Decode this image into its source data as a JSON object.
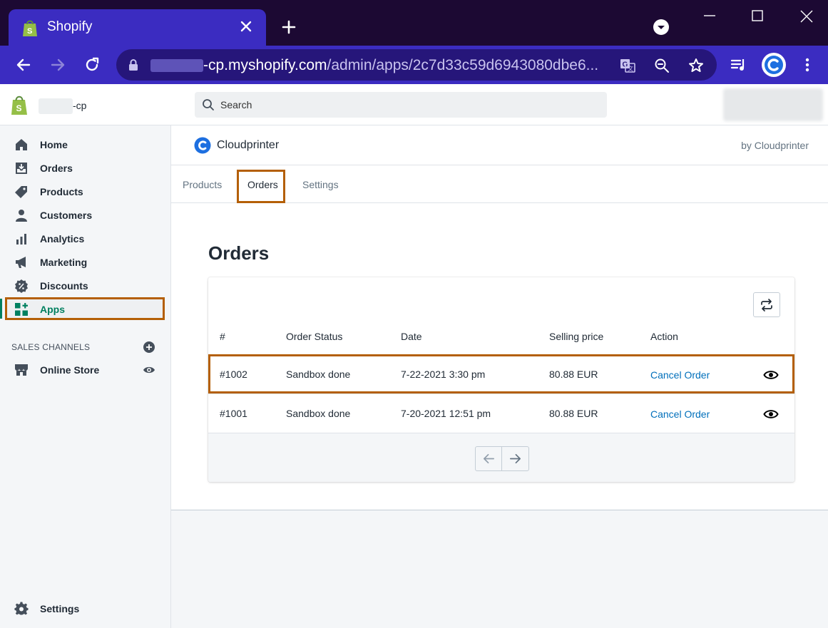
{
  "browser": {
    "tab_title": "Shopify",
    "url_host": "-cp.myshopify.com",
    "url_path": "/admin/apps/2c7d33c59d6943080dbe6..."
  },
  "topbar": {
    "store_name": "-cp",
    "search_placeholder": "Search"
  },
  "sidebar": {
    "items": [
      {
        "label": "Home",
        "icon": "home-icon"
      },
      {
        "label": "Orders",
        "icon": "orders-icon"
      },
      {
        "label": "Products",
        "icon": "tag-icon"
      },
      {
        "label": "Customers",
        "icon": "person-icon"
      },
      {
        "label": "Analytics",
        "icon": "bar-chart-icon"
      },
      {
        "label": "Marketing",
        "icon": "megaphone-icon"
      },
      {
        "label": "Discounts",
        "icon": "discount-icon"
      },
      {
        "label": "Apps",
        "icon": "apps-icon"
      }
    ],
    "sales_channels_title": "SALES CHANNELS",
    "online_store": "Online Store",
    "settings": "Settings"
  },
  "app": {
    "name": "Cloudprinter",
    "by": "by Cloudprinter",
    "tabs": [
      "Products",
      "Orders",
      "Settings"
    ],
    "selected_tab": "Orders"
  },
  "orders": {
    "title": "Orders",
    "columns": [
      "#",
      "Order Status",
      "Date",
      "Selling price",
      "Action"
    ],
    "rows": [
      {
        "id": "#1002",
        "status": "Sandbox done",
        "date": "7-22-2021 3:30 pm",
        "price": "80.88 EUR",
        "action": "Cancel Order"
      },
      {
        "id": "#1001",
        "status": "Sandbox done",
        "date": "7-20-2021 12:51 pm",
        "price": "80.88 EUR",
        "action": "Cancel Order"
      }
    ]
  },
  "colors": {
    "chrome_dark": "#1c0933",
    "chrome_accent": "#3b2cc1",
    "highlight": "#b45f06",
    "shopify_green": "#008060",
    "link": "#006fbb"
  }
}
